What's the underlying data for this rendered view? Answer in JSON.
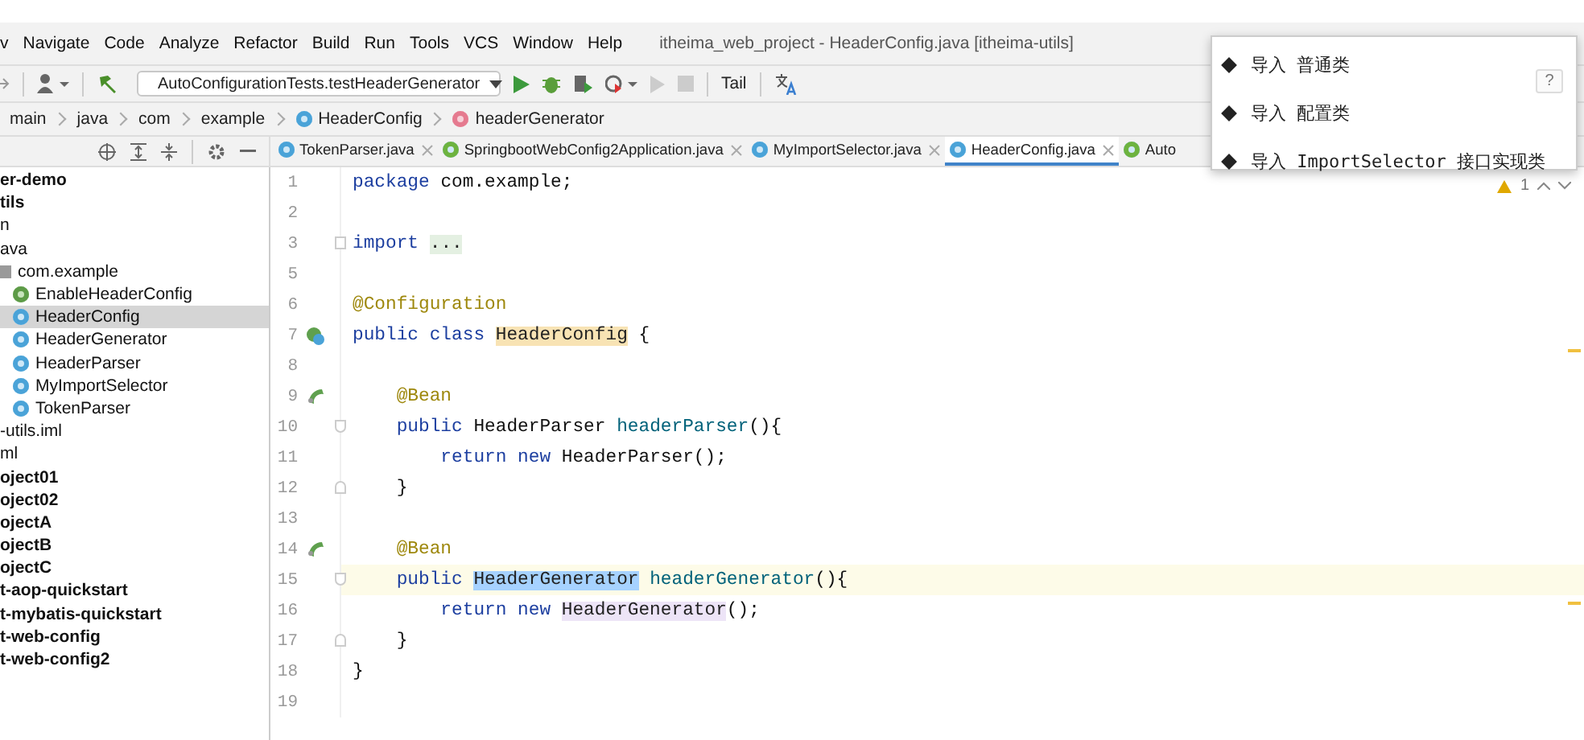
{
  "menu": {
    "items": [
      "v",
      "Navigate",
      "Code",
      "Analyze",
      "Refactor",
      "Build",
      "Run",
      "Tools",
      "VCS",
      "Window",
      "Help"
    ],
    "title": "itheima_web_project - HeaderConfig.java [itheima-utils]"
  },
  "toolbar": {
    "run_config": "AutoConfigurationTests.testHeaderGenerator",
    "tail": "Tail"
  },
  "breadcrumbs": [
    {
      "label": "main"
    },
    {
      "label": "java"
    },
    {
      "label": "com"
    },
    {
      "label": "example"
    },
    {
      "label": "HeaderConfig",
      "kind": "class"
    },
    {
      "label": "headerGenerator",
      "kind": "method"
    }
  ],
  "tabs": [
    {
      "label": "TokenParser.java",
      "kind": "class",
      "selected": false,
      "closable": true
    },
    {
      "label": "SpringbootWebConfig2Application.java",
      "kind": "spring-class",
      "selected": false,
      "closable": true
    },
    {
      "label": "MyImportSelector.java",
      "kind": "class",
      "selected": false,
      "closable": true
    },
    {
      "label": "HeaderConfig.java",
      "kind": "class",
      "selected": true,
      "closable": true
    },
    {
      "label": "Auto",
      "kind": "spring-class",
      "selected": false,
      "closable": false
    }
  ],
  "project_tree": [
    {
      "label": "er-demo",
      "bold": true,
      "selected": false
    },
    {
      "label": "tils",
      "bold": true,
      "selected": false
    },
    {
      "label": "n",
      "bold": false,
      "selected": false
    },
    {
      "label": "ava",
      "bold": false,
      "selected": false
    },
    {
      "label": "com.example",
      "kind": "package",
      "bold": false,
      "selected": false,
      "children": [
        {
          "label": "EnableHeaderConfig",
          "kind": "annotation",
          "bold": false,
          "selected": false
        },
        {
          "label": "HeaderConfig",
          "kind": "class",
          "bold": false,
          "selected": true
        },
        {
          "label": "HeaderGenerator",
          "kind": "class",
          "bold": false,
          "selected": false
        },
        {
          "label": "HeaderParser",
          "kind": "class",
          "bold": false,
          "selected": false
        },
        {
          "label": "MyImportSelector",
          "kind": "class",
          "bold": false,
          "selected": false
        },
        {
          "label": "TokenParser",
          "kind": "class",
          "bold": false,
          "selected": false
        }
      ]
    },
    {
      "label": "-utils.iml",
      "bold": false,
      "selected": false
    },
    {
      "label": "ml",
      "bold": false,
      "selected": false
    },
    {
      "label": "oject01",
      "bold": true,
      "selected": false
    },
    {
      "label": "oject02",
      "bold": true,
      "selected": false
    },
    {
      "label": "ojectA",
      "bold": true,
      "selected": false
    },
    {
      "label": "ojectB",
      "bold": true,
      "selected": false
    },
    {
      "label": "ojectC",
      "bold": true,
      "selected": false
    },
    {
      "label": "t-aop-quickstart",
      "bold": true,
      "selected": false
    },
    {
      "label": "t-mybatis-quickstart",
      "bold": true,
      "selected": false
    },
    {
      "label": "t-web-config",
      "bold": true,
      "selected": false
    },
    {
      "label": "t-web-config2",
      "bold": true,
      "selected": false
    }
  ],
  "editor": {
    "warnings": "1",
    "lines": [
      {
        "number": "1",
        "current": false,
        "tokens": [
          {
            "text": "package",
            "kind": "keyword"
          },
          {
            "text": " com.example;",
            "kind": "plain"
          }
        ]
      },
      {
        "number": "2",
        "current": false
      },
      {
        "number": "3",
        "current": false,
        "tokens": [
          {
            "text": "import ",
            "kind": "keyword"
          },
          {
            "text": "...",
            "kind": "folded"
          }
        ]
      },
      {
        "number": "5",
        "current": false
      },
      {
        "number": "6",
        "current": false,
        "tokens": [
          {
            "text": "@Configuration",
            "kind": "annotation"
          }
        ]
      },
      {
        "number": "7",
        "current": false,
        "tokens": [
          {
            "text": "public class ",
            "kind": "keyword"
          },
          {
            "text": "HeaderConfig",
            "kind": "declaration"
          },
          {
            "text": " {",
            "kind": "plain"
          }
        ]
      },
      {
        "number": "8",
        "current": false
      },
      {
        "number": "9",
        "current": false,
        "tokens": [
          {
            "text": "    @Bean",
            "kind": "annotation"
          }
        ]
      },
      {
        "number": "10",
        "current": false,
        "tokens": [
          {
            "text": "    public",
            "kind": "keyword"
          },
          {
            "text": " HeaderParser ",
            "kind": "plain"
          },
          {
            "text": "headerParser",
            "kind": "method"
          },
          {
            "text": "(){",
            "kind": "plain"
          }
        ]
      },
      {
        "number": "11",
        "current": false,
        "tokens": [
          {
            "text": "        return new",
            "kind": "keyword"
          },
          {
            "text": " HeaderParser();",
            "kind": "plain"
          }
        ]
      },
      {
        "number": "12",
        "current": false,
        "tokens": [
          {
            "text": "    }",
            "kind": "plain"
          }
        ]
      },
      {
        "number": "13",
        "current": false
      },
      {
        "number": "14",
        "current": false,
        "tokens": [
          {
            "text": "    @Bean",
            "kind": "annotation"
          }
        ]
      },
      {
        "number": "15",
        "current": true,
        "tokens": [
          {
            "text": "    public ",
            "kind": "keyword"
          },
          {
            "text": "HeaderGenerator",
            "kind": "selection"
          },
          {
            "text": " headerGenerator",
            "kind": "method"
          },
          {
            "text": "(){",
            "kind": "plain"
          }
        ]
      },
      {
        "number": "16",
        "current": false,
        "tokens": [
          {
            "text": "        return new ",
            "kind": "keyword"
          },
          {
            "text": "HeaderGenerator",
            "kind": "usage"
          },
          {
            "text": "();",
            "kind": "plain"
          }
        ]
      },
      {
        "number": "17",
        "current": false,
        "tokens": [
          {
            "text": "    }",
            "kind": "plain"
          }
        ]
      },
      {
        "number": "18",
        "current": false,
        "tokens": [
          {
            "text": "}",
            "kind": "plain"
          }
        ]
      },
      {
        "number": "19",
        "current": false
      }
    ]
  },
  "popup": {
    "help": "?",
    "items": [
      "导入 普通类",
      "导入 配置类",
      "导入 ImportSelector 接口实现类"
    ]
  }
}
